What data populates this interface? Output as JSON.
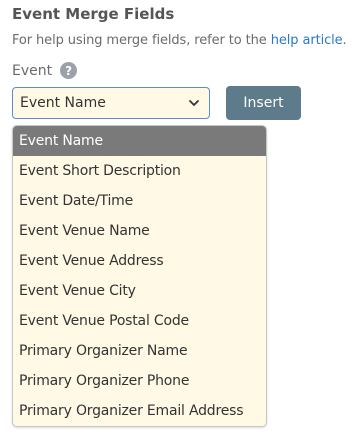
{
  "section": {
    "title": "Event Merge Fields",
    "help_prefix": "For help using merge fields, refer to the ",
    "help_link": "help article",
    "help_suffix": "."
  },
  "field": {
    "label": "Event",
    "help_icon": "question-circle-icon",
    "selected_value": "Event Name"
  },
  "insert_button": {
    "label": "Insert"
  },
  "dropdown": {
    "options": [
      "Event Name",
      "Event Short Description",
      "Event Date/Time",
      "Event Venue Name",
      "Event Venue Address",
      "Event Venue City",
      "Event Venue Postal Code",
      "Primary Organizer Name",
      "Primary Organizer Phone",
      "Primary Organizer Email Address"
    ],
    "highlighted_index": 0
  },
  "colors": {
    "link": "#2b78c4",
    "select_bg": "#fff9e6",
    "button_bg": "#5d7b8a",
    "highlight_bg": "#7a7a7a"
  }
}
